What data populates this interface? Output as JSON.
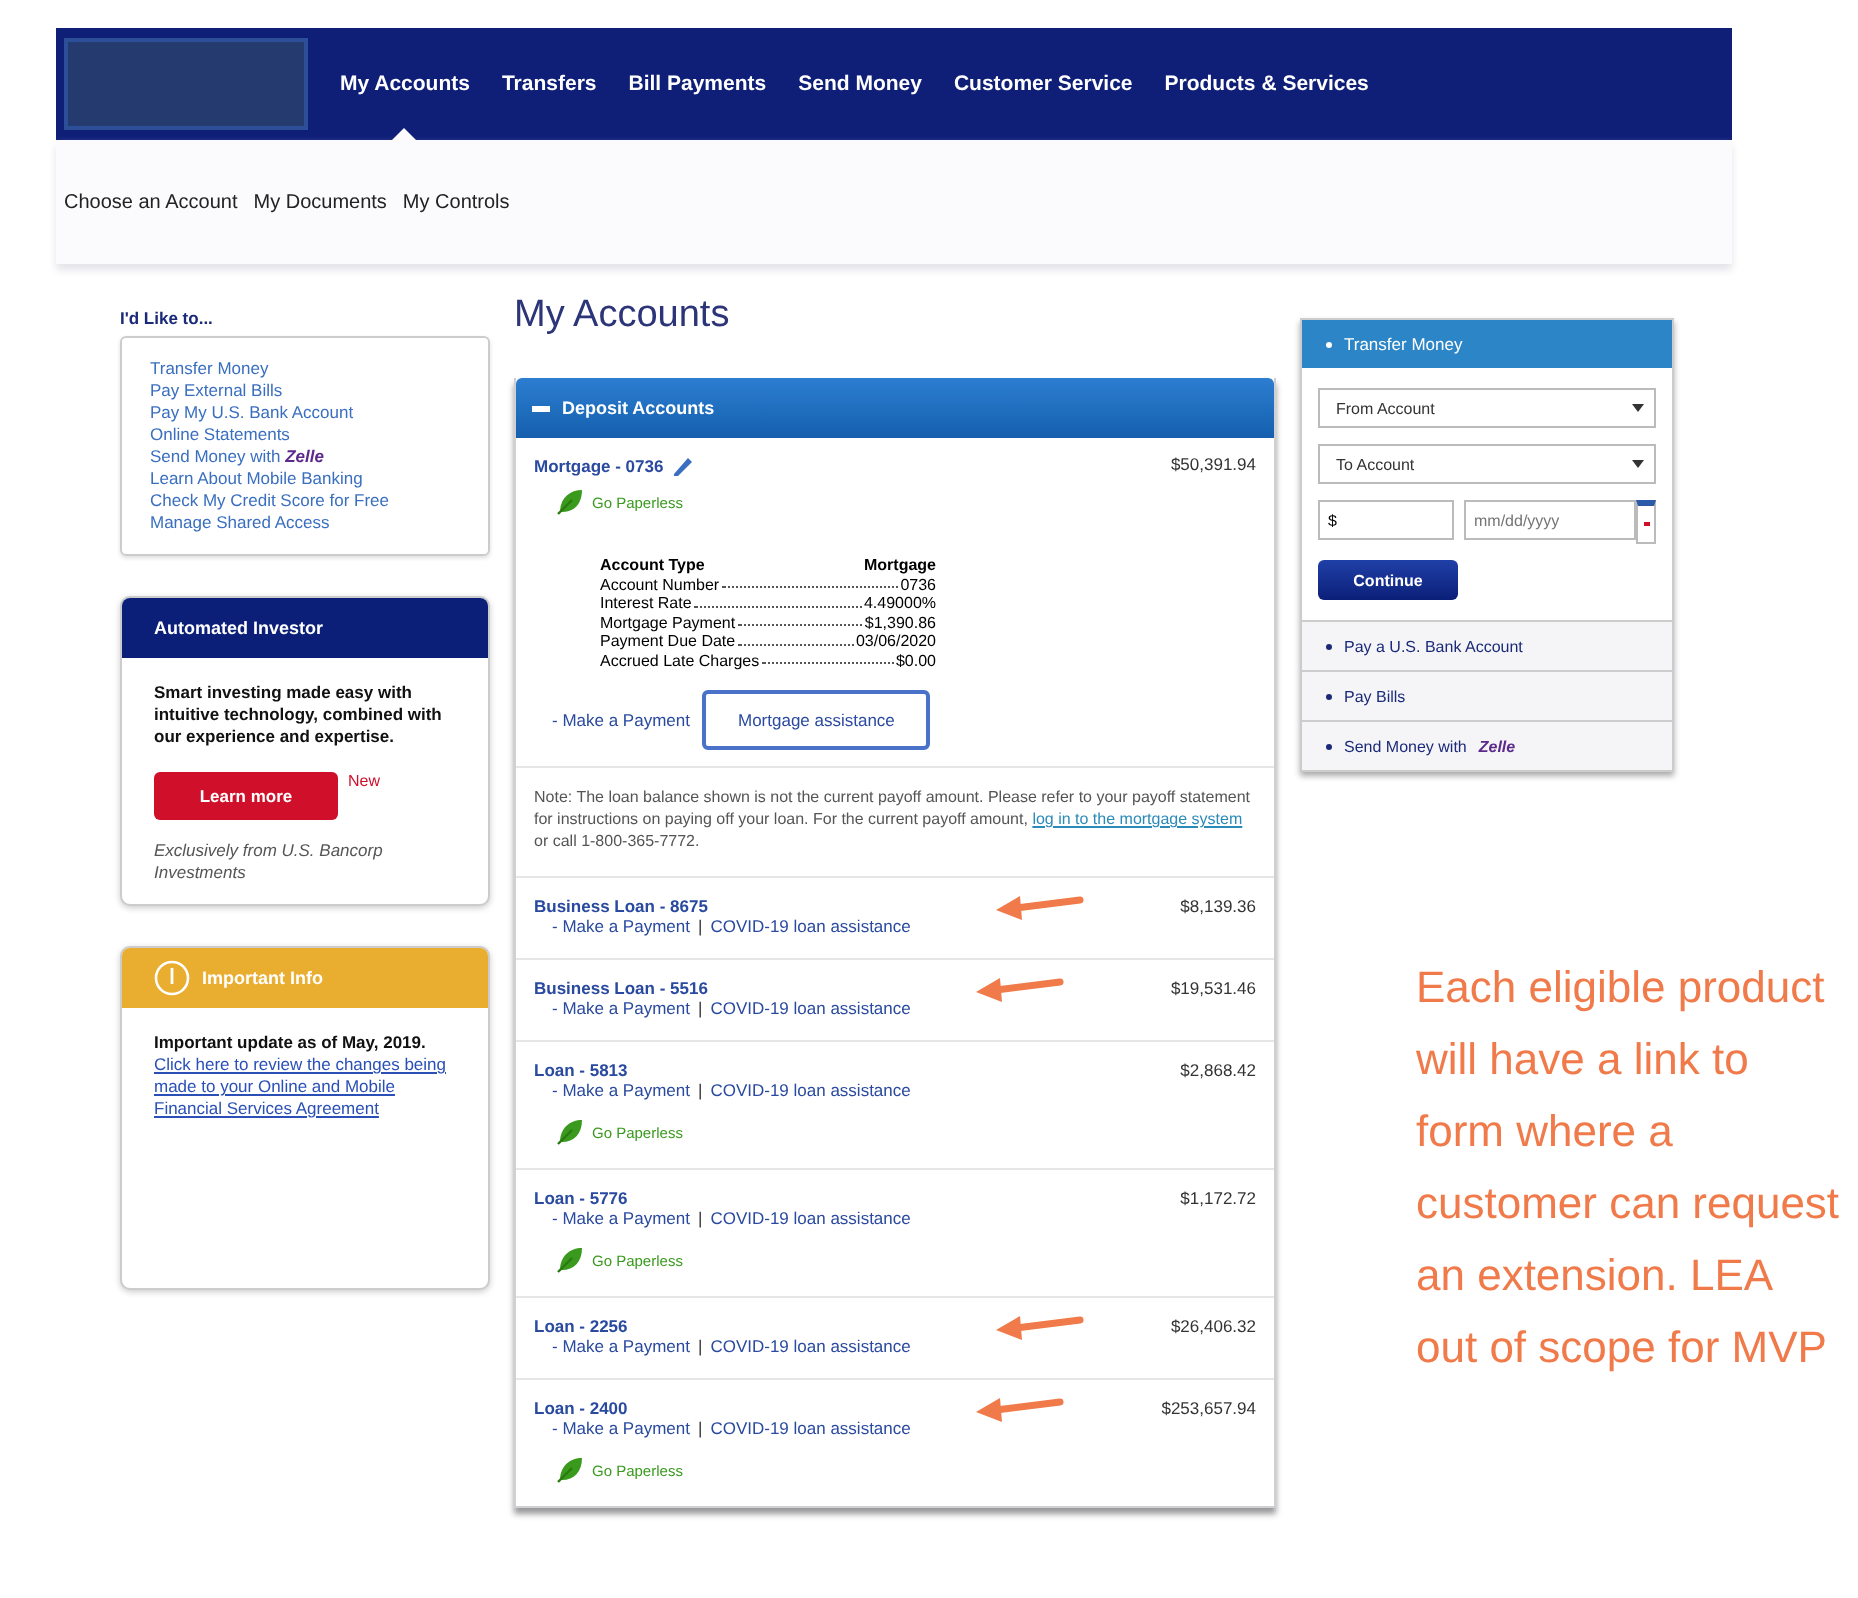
{
  "nav": {
    "items": [
      {
        "label": "My Accounts",
        "selected": true
      },
      {
        "label": "Transfers",
        "selected": false
      },
      {
        "label": "Bill Payments",
        "selected": false
      },
      {
        "label": "Send Money",
        "selected": false
      },
      {
        "label": "Customer Service",
        "selected": false
      },
      {
        "label": "Products & Services",
        "selected": false
      }
    ]
  },
  "subnav": {
    "items": [
      "Choose an Account",
      "My Documents",
      "My Controls"
    ]
  },
  "sidebar": {
    "title": "I'd Like to...",
    "links": [
      {
        "label": "Transfer Money"
      },
      {
        "label": "Pay External Bills"
      },
      {
        "label": "Pay My U.S. Bank Account"
      },
      {
        "label": "Online Statements"
      },
      {
        "label": "Send Money with",
        "brand": "Zelle"
      },
      {
        "label": "Learn About Mobile Banking"
      },
      {
        "label": "Check My Credit Score for Free"
      },
      {
        "label": "Manage Shared Access"
      }
    ],
    "investor": {
      "title": "Automated Investor",
      "body": "Smart investing made easy with intuitive technology, combined with our experience and expertise.",
      "button": "Learn more",
      "badge": "New",
      "footnote": "Exclusively from U.S. Bancorp Investments"
    },
    "info": {
      "title": "Important Info",
      "lead": "Important update as of May, 2019.",
      "link": "Click here to review the changes being made to your Online and Mobile Financial Services Agreement"
    }
  },
  "main": {
    "title": "My Accounts",
    "section": {
      "title": "Deposit Accounts",
      "expanded": true
    },
    "mortgage": {
      "name": "Mortgage - 0736",
      "balance": "$50,391.94",
      "paperless": "Go Paperless",
      "details": [
        {
          "label": "Account Type",
          "value": "Mortgage"
        },
        {
          "label": "Account Number",
          "value": "0736"
        },
        {
          "label": "Interest Rate",
          "value": "4.49000%"
        },
        {
          "label": "Mortgage Payment",
          "value": "$1,390.86"
        },
        {
          "label": "Payment Due Date",
          "value": "03/06/2020"
        },
        {
          "label": "Accrued Late Charges",
          "value": "$0.00"
        }
      ],
      "payment_link": "- Make a Payment",
      "assistance_button": "Mortgage assistance",
      "note": {
        "before": "Note: The loan balance shown is not the current payoff amount. Please refer to your payoff statement for instructions on paying off your loan. For the current payoff amount,",
        "link": "log in to the mortgage system",
        "after": "or call 1-800-365-7772."
      }
    },
    "loans": [
      {
        "name": "Business Loan - 8675",
        "balance": "$8,139.36",
        "payment_link": "- Make a Payment",
        "separator": "|",
        "assistance_link": "COVID-19 loan assistance",
        "annotated": true
      },
      {
        "name": "Business Loan - 5516",
        "balance": "$19,531.46",
        "payment_link": "- Make a Payment",
        "separator": "|",
        "assistance_link": "COVID-19 loan assistance",
        "annotated": true
      },
      {
        "name": "Loan - 5813",
        "balance": "$2,868.42",
        "payment_link": "- Make a Payment",
        "separator": "|",
        "assistance_link": "COVID-19 loan assistance",
        "paperless": "Go Paperless",
        "annotated": false
      },
      {
        "name": "Loan - 5776",
        "balance": "$1,172.72",
        "payment_link": "- Make a Payment",
        "separator": "|",
        "assistance_link": "COVID-19 loan assistance",
        "paperless": "Go Paperless",
        "annotated": false
      },
      {
        "name": "Loan - 2256",
        "balance": "$26,406.32",
        "payment_link": "- Make a Payment",
        "separator": "|",
        "assistance_link": "COVID-19 loan assistance",
        "annotated": true
      },
      {
        "name": "Loan - 2400",
        "balance": "$253,657.94",
        "payment_link": "- Make a Payment",
        "separator": "|",
        "assistance_link": "COVID-19 loan assistance",
        "paperless": "Go Paperless",
        "annotated": true
      }
    ]
  },
  "transfer": {
    "title": "Transfer Money",
    "expanded": true,
    "from": "From Account",
    "to": "To Account",
    "amount": "$",
    "date": {
      "placeholder": "mm/dd/yyyy"
    },
    "button": "Continue",
    "items": [
      {
        "label": "Pay a U.S. Bank Account"
      },
      {
        "label": "Pay Bills"
      },
      {
        "label": "Send Money with",
        "brand": "Zelle"
      }
    ]
  },
  "annotation": {
    "text": "Each eligible product will have a link to form where a customer can request an extension. LEA out of scope for MVP"
  }
}
